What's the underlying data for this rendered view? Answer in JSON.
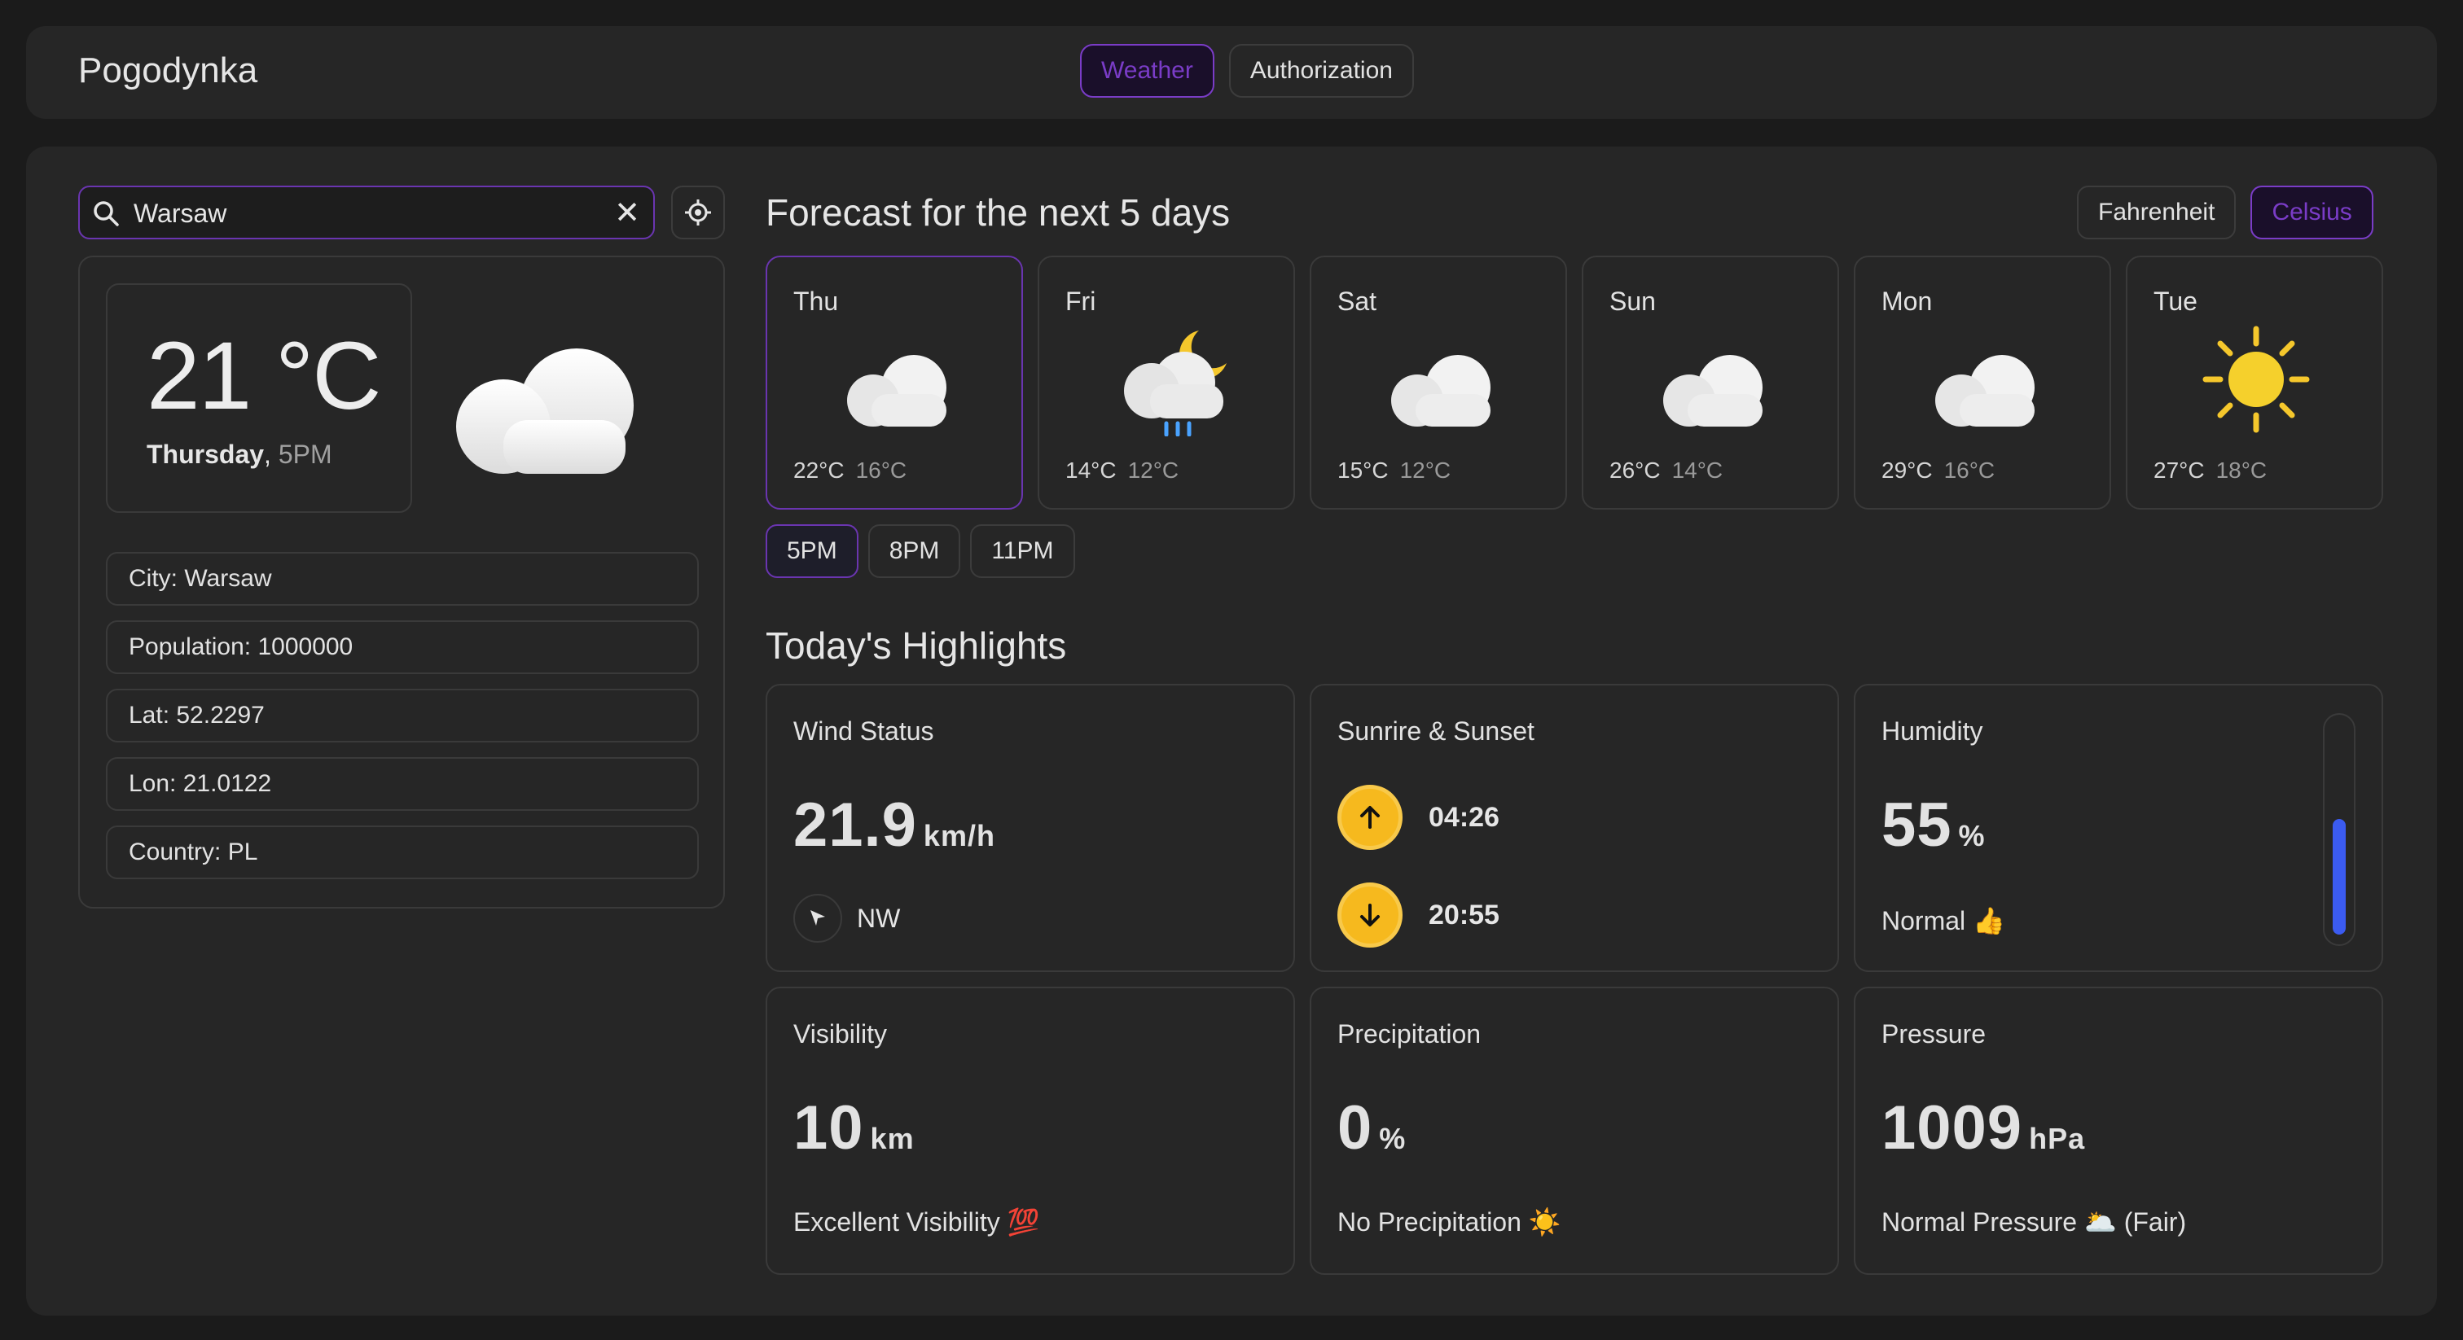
{
  "header": {
    "app_title": "Pogodynka",
    "nav": [
      {
        "label": "Weather",
        "active": true
      },
      {
        "label": "Authorization",
        "active": false
      }
    ]
  },
  "search": {
    "value": "Warsaw",
    "clear_glyph": "✕"
  },
  "current": {
    "temperature": "21 °C",
    "day": "Thursday",
    "separator": ",",
    "time": " 5PM",
    "icon": "cloud-icon"
  },
  "city_info": {
    "city": "City: Warsaw",
    "population": "Population: 1000000",
    "lat": "Lat: 52.2297",
    "lon": "Lon: 21.0122",
    "country": "Country: PL"
  },
  "forecast": {
    "title": "Forecast for the next 5 days",
    "units": [
      {
        "label": "Fahrenheit",
        "active": false
      },
      {
        "label": "Celsius",
        "active": true
      }
    ],
    "days": [
      {
        "name": "Thu",
        "hi": "22°C",
        "lo": "16°C",
        "icon": "cloud-icon"
      },
      {
        "name": "Fri",
        "hi": "14°C",
        "lo": "12°C",
        "icon": "rain-night-icon"
      },
      {
        "name": "Sat",
        "hi": "15°C",
        "lo": "12°C",
        "icon": "cloud-icon"
      },
      {
        "name": "Sun",
        "hi": "26°C",
        "lo": "14°C",
        "icon": "cloud-icon"
      },
      {
        "name": "Mon",
        "hi": "29°C",
        "lo": "16°C",
        "icon": "cloud-icon"
      },
      {
        "name": "Tue",
        "hi": "27°C",
        "lo": "18°C",
        "icon": "sun-icon"
      }
    ],
    "hours": [
      {
        "label": "5PM",
        "active": true
      },
      {
        "label": "8PM",
        "active": false
      },
      {
        "label": "11PM",
        "active": false
      }
    ]
  },
  "highlights": {
    "title": "Today's Highlights",
    "wind": {
      "label": "Wind Status",
      "value": "21.9",
      "unit": "km/h",
      "direction": "NW"
    },
    "sun": {
      "label": "Sunrire & Sunset",
      "sunrise": "04:26",
      "sunset": "20:55"
    },
    "humidity": {
      "label": "Humidity",
      "value": "55",
      "unit": "%",
      "status": "Normal 👍",
      "level": 0.55
    },
    "visibility": {
      "label": "Visibility",
      "value": "10",
      "unit": "km",
      "status": "Excellent Visibility 💯"
    },
    "precipitation": {
      "label": "Precipitation",
      "value": "0",
      "unit": "%",
      "status": "No Precipitation ☀️"
    },
    "pressure": {
      "label": "Pressure",
      "value": "1009",
      "unit": "hPa",
      "status": "Normal Pressure 🌥️ (Fair)"
    }
  },
  "colors": {
    "accent": "#7a3cc7",
    "background": "#1b1b1b",
    "panel": "#262626",
    "sun_badge": "#f6b91e",
    "humidity_bar": "#3b5bf0"
  }
}
